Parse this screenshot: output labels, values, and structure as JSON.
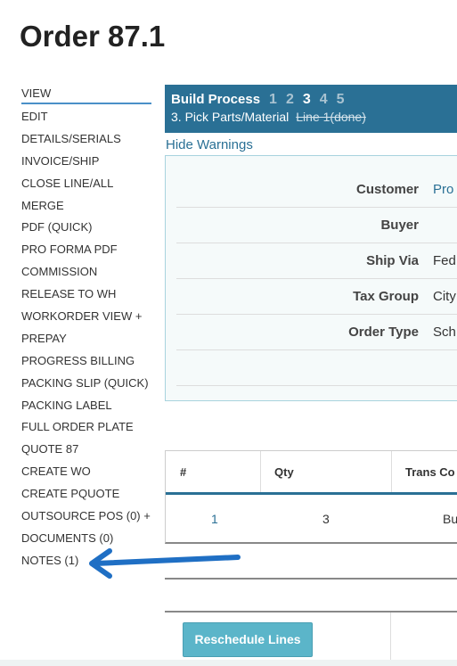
{
  "title": "Order 87.1",
  "nav": [
    "VIEW",
    "EDIT",
    "DETAILS/SERIALS",
    "INVOICE/SHIP",
    "CLOSE LINE/ALL",
    "MERGE",
    "PDF (QUICK)",
    "PRO FORMA PDF",
    "COMMISSION",
    "RELEASE TO WH",
    "WORKORDER VIEW +",
    "PREPAY",
    "PROGRESS BILLING",
    "PACKING SLIP (QUICK)",
    "PACKING LABEL",
    "FULL ORDER PLATE",
    "QUOTE 87",
    "CREATE WO",
    "CREATE PQUOTE",
    "OUTSOURCE POS (0) +",
    "DOCUMENTS (0)",
    "NOTES (1)"
  ],
  "build": {
    "title": "Build Process",
    "steps": [
      "1",
      "2",
      "3",
      "4",
      "5"
    ],
    "current_step": "3",
    "subtitle": "3. Pick Parts/Material",
    "done": "Line 1(done)"
  },
  "hide_warnings": "Hide Warnings",
  "fields": [
    {
      "label": "Customer",
      "value": "Pro"
    },
    {
      "label": "Buyer",
      "value": ""
    },
    {
      "label": "Ship Via",
      "value": "Fed"
    },
    {
      "label": "Tax Group",
      "value": "City"
    },
    {
      "label": "Order Type",
      "value": "Sch"
    }
  ],
  "table": {
    "headers": [
      "#",
      "Qty",
      "Trans Co"
    ],
    "rows": [
      [
        "1",
        "3",
        "Bu"
      ]
    ]
  },
  "reschedule": "Reschedule Lines",
  "colors": {
    "accent": "#2a7095",
    "arrow": "#1f6fc4"
  }
}
